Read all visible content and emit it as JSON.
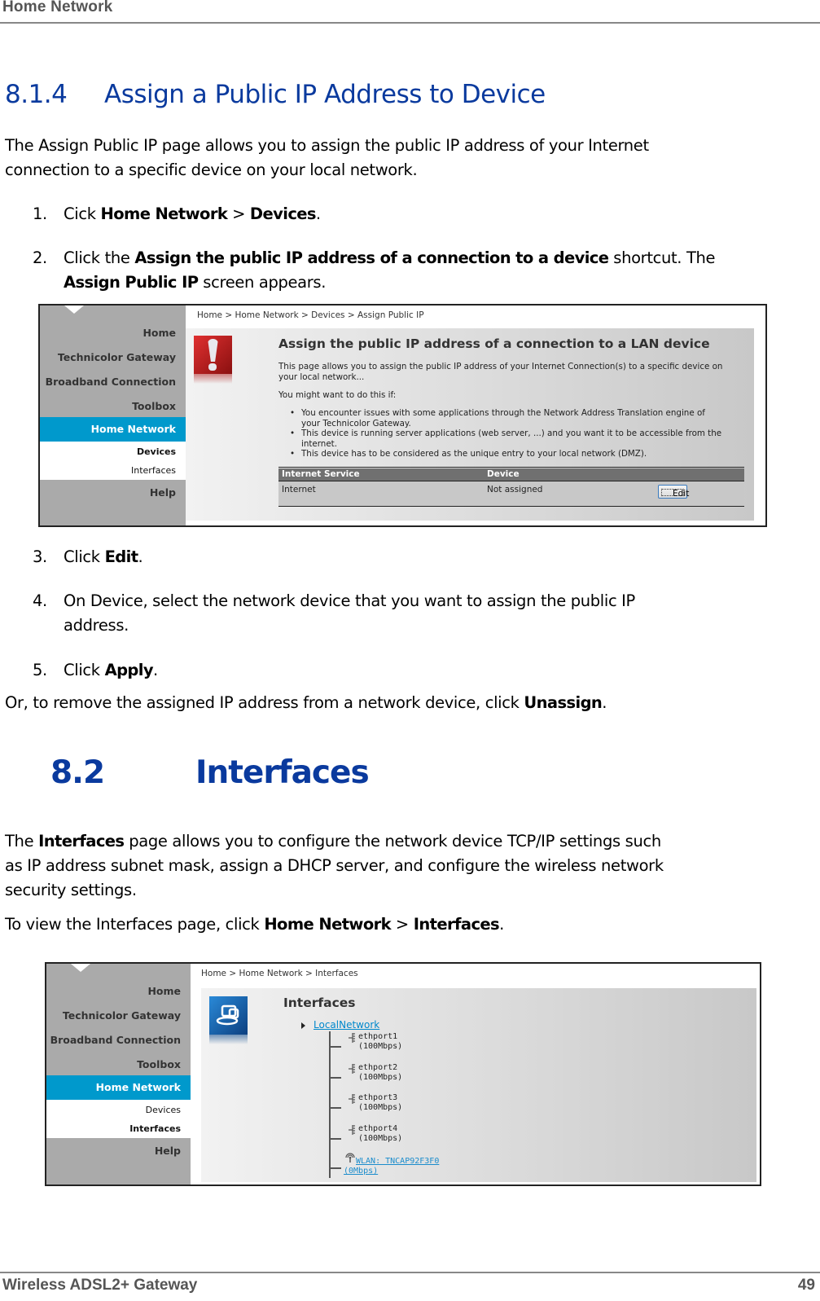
{
  "header": {
    "running_title": "Home Network"
  },
  "section_814": {
    "number": "8.1.4",
    "title": "Assign a Public IP Address to Device",
    "intro_line1": "The Assign Public IP page allows you to assign the public IP address of your Internet",
    "intro_line2": "connection to a specific device on your local network.",
    "steps": [
      {
        "n": "1.",
        "pre": "Cick ",
        "b1": "Home Network",
        "mid": " > ",
        "b2": "Devices",
        "post": "."
      },
      {
        "n": "2.",
        "pre": "Click the ",
        "b1": "Assign the public IP address of a connection to a device",
        "mid": " shortcut. The",
        "b2": "Assign Public IP",
        "post": " screen appears."
      },
      {
        "n": "3.",
        "pre": "Click ",
        "b1": "Edit",
        "post": "."
      },
      {
        "n": "4.",
        "line1": "On Device, select the network device that you want to assign the public IP",
        "line2": "address."
      },
      {
        "n": "5.",
        "pre": "Click ",
        "b1": "Apply",
        "post": "."
      }
    ],
    "remove_note": {
      "pre": "Or, to remove the assigned IP address from a network device, click ",
      "bold": "Unassign",
      "post": "."
    }
  },
  "screenshot1": {
    "nav": {
      "items": [
        "Home",
        "Technicolor Gateway",
        "Broadband Connection",
        "Toolbox"
      ],
      "active": "Home Network",
      "subitems": [
        "Devices",
        "Interfaces"
      ],
      "active_sub": "Devices",
      "help": "Help"
    },
    "breadcrumb": "Home > Home Network > Devices > Assign Public IP",
    "icon": "alert-icon",
    "title": "Assign the public IP address of a connection to a LAN device",
    "desc_line1": "This page allows you to assign the public IP address of your Internet Connection(s) to a specific device on",
    "desc_line2": "your local network...",
    "might": "You might want to do this if:",
    "bullets": [
      {
        "l1": "You encounter issues with some applications through the Network Address Translation engine of",
        "l2": "your Technicolor Gateway."
      },
      {
        "l1": "This device is running server applications (web server, ...) and you want it to be accessible from the",
        "l2": "internet."
      },
      {
        "l1": "This device has to be considered as the unique entry to your local network (DMZ).",
        "l2": ""
      }
    ],
    "table": {
      "headers": [
        "Internet Service",
        "Device"
      ],
      "rows": [
        {
          "service": "Internet",
          "device": "Not assigned",
          "action": "Edit"
        }
      ]
    }
  },
  "section_82": {
    "number": "8.2",
    "title": "Interfaces",
    "intro": {
      "pre": "The ",
      "bold": "Interfaces",
      "line1_post": " page allows you to configure the network device TCP/IP settings such",
      "line2": "as IP address subnet mask, assign a DHCP server, and configure the wireless network",
      "line3": "security settings."
    },
    "view": {
      "pre": "To view the Interfaces page, click ",
      "b1": "Home Network",
      "mid": " > ",
      "b2": "Interfaces",
      "post": "."
    }
  },
  "screenshot2": {
    "nav": {
      "items": [
        "Home",
        "Technicolor Gateway",
        "Broadband Connection",
        "Toolbox"
      ],
      "active": "Home Network",
      "subitems": [
        "Devices",
        "Interfaces"
      ],
      "active_sub": "Interfaces",
      "help": "Help"
    },
    "breadcrumb": "Home > Home Network > Interfaces",
    "icon": "network-icon",
    "title": "Interfaces",
    "root": "LocalNetwork",
    "ports": [
      {
        "name": "ethport1",
        "speed": "(100Mbps)"
      },
      {
        "name": "ethport2",
        "speed": "(100Mbps)"
      },
      {
        "name": "ethport3",
        "speed": "(100Mbps)"
      },
      {
        "name": "ethport4",
        "speed": "(100Mbps)"
      }
    ],
    "wlan": {
      "name": "WLAN: TNCAP92F3F0",
      "speed": "(0Mbps)"
    }
  },
  "footer": {
    "product": "Wireless ADSL2+ Gateway",
    "page": "49"
  },
  "colors": {
    "heading_blue": "#0a3a9e",
    "nav_active": "#0099cc",
    "nav_bg": "#aaaaaa",
    "link": "#0088cc"
  }
}
